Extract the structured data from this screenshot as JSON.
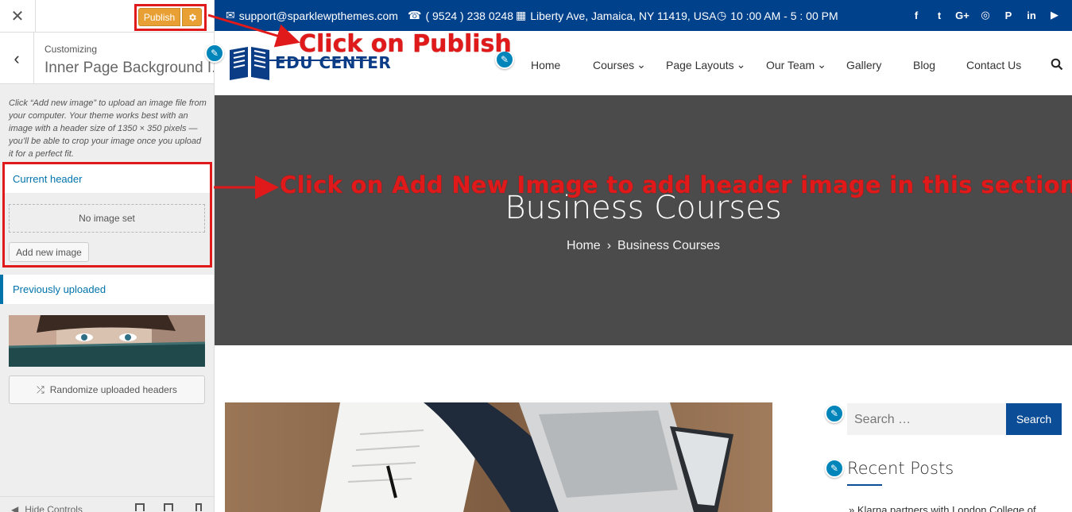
{
  "customizer": {
    "close_icon": "close-icon",
    "publish_label": "Publish",
    "settings_icon": "gear-icon",
    "back_icon": "chevron-left-icon",
    "subtitle": "Customizing",
    "title": "Inner Page Background I...",
    "description": "Click “Add new image” to upload an image file from your computer. Your theme works best with an image with a header size of 1350 × 350 pixels — you’ll be able to crop your image once you upload it for a perfect fit.",
    "current_header": {
      "title": "Current header",
      "no_image_text": "No image set",
      "add_button": "Add new image"
    },
    "previously_uploaded": {
      "title": "Previously uploaded",
      "randomize_button": "Randomize uploaded headers"
    },
    "footer": {
      "hide_controls": "Hide Controls"
    },
    "colors": {
      "publish": "#e8a035",
      "link": "#0073aa"
    }
  },
  "site": {
    "topbar": {
      "email": "support@sparklewpthemes.com",
      "phone": "( 9524 ) 238 0248",
      "address": "Liberty Ave, Jamaica, NY 11419, USA",
      "hours": "10 :00 AM - 5 : 00 PM",
      "social_icons": [
        "facebook-icon",
        "twitter-icon",
        "google-plus-icon",
        "instagram-icon",
        "pinterest-icon",
        "linkedin-icon",
        "youtube-icon"
      ]
    },
    "logo_text": "EDU CENTER",
    "nav": [
      "Home",
      "Courses",
      "Page Layouts",
      "Our Team",
      "Gallery",
      "Blog",
      "Contact Us"
    ],
    "banner": {
      "title": "Business Courses",
      "breadcrumb_home": "Home",
      "breadcrumb_current": "Business Courses"
    },
    "sidebar": {
      "search_placeholder": "Search …",
      "search_button": "Search",
      "recent_posts_title": "Recent Posts",
      "recent_post_1": "Klarna partners with London College of"
    },
    "colors": {
      "primary": "#00418b",
      "banner": "#4b4b4b"
    }
  },
  "annotations": {
    "publish": "Click on Publish",
    "add_image": "Click on Add New Image to add header image in this section"
  }
}
